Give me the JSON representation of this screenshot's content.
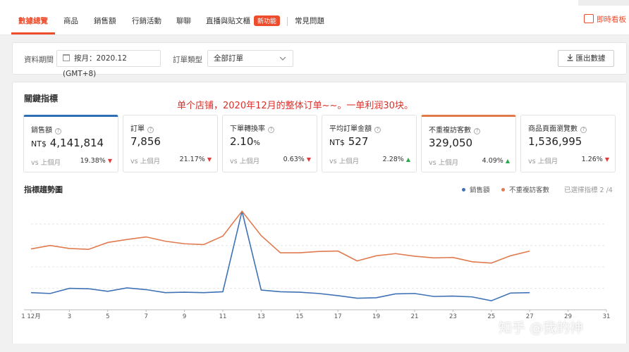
{
  "nav": {
    "tabs": [
      "數據總覽",
      "商品",
      "銷售額",
      "行銷活動",
      "聊聊",
      "直播與貼文櫃"
    ],
    "badge": "新功能",
    "faq": "常見問題",
    "dashboard": "即時看板"
  },
  "filters": {
    "period_label": "資料期間",
    "period_value": "按月：2020.12 (GMT+8)",
    "order_type_label": "訂單類型",
    "order_type_value": "全部訂單",
    "export_label": "匯出數據"
  },
  "metrics": {
    "title": "關鍵指標",
    "annotation": "单个店铺，2020年12月的整体订单~~。一单利润30块。",
    "cards": [
      {
        "label": "銷售額",
        "prefix": "NT$",
        "value": "4,141,814",
        "suffix": "",
        "vs": "vs 上個月",
        "change": "19.38%",
        "direction": "down"
      },
      {
        "label": "訂單",
        "prefix": "",
        "value": "7,856",
        "suffix": "",
        "vs": "vs 上個月",
        "change": "21.17%",
        "direction": "down"
      },
      {
        "label": "下單轉換率",
        "prefix": "",
        "value": "2.10",
        "suffix": "%",
        "vs": "vs 上個月",
        "change": "0.63%",
        "direction": "down"
      },
      {
        "label": "平均訂單金額",
        "prefix": "NT$",
        "value": "527",
        "suffix": "",
        "vs": "vs 上個月",
        "change": "2.28%",
        "direction": "up"
      },
      {
        "label": "不重複訪客數",
        "prefix": "",
        "value": "329,050",
        "suffix": "",
        "vs": "vs 上個月",
        "change": "4.09%",
        "direction": "up"
      },
      {
        "label": "商品頁面瀏覽數",
        "prefix": "",
        "value": "1,536,995",
        "suffix": "",
        "vs": "vs 上個月",
        "change": "1.26%",
        "direction": "down"
      }
    ]
  },
  "trend": {
    "title": "指標趨勢圖",
    "legend": [
      "銷售額",
      "不重複訪客數"
    ],
    "selected_note": "已選擇指標 2 /4"
  },
  "chart_data": {
    "type": "line",
    "x": [
      1,
      2,
      3,
      4,
      5,
      6,
      7,
      8,
      9,
      10,
      11,
      12,
      13,
      14,
      15,
      16,
      17,
      18,
      19,
      20,
      21,
      22,
      23,
      24,
      25,
      26,
      27
    ],
    "x_ticks": [
      "1 12月",
      "3",
      "5",
      "7",
      "9",
      "11",
      "13",
      "15",
      "17",
      "19",
      "21",
      "23",
      "25",
      "27",
      "29",
      "31"
    ],
    "xlim": [
      1,
      31
    ],
    "series": [
      {
        "name": "銷售額",
        "color": "#3f72b5",
        "values": [
          0.4,
          0.38,
          0.5,
          0.49,
          0.43,
          0.51,
          0.47,
          0.4,
          0.41,
          0.4,
          0.42,
          2.3,
          0.46,
          0.42,
          0.41,
          0.38,
          0.33,
          0.27,
          0.28,
          0.37,
          0.38,
          0.31,
          0.32,
          0.3,
          0.21,
          0.39,
          0.4
        ]
      },
      {
        "name": "不重複訪客數",
        "color": "#e07b50",
        "values": [
          1.42,
          1.5,
          1.43,
          1.41,
          1.57,
          1.64,
          1.7,
          1.6,
          1.54,
          1.52,
          1.72,
          2.3,
          1.73,
          1.33,
          1.33,
          1.36,
          1.37,
          1.14,
          1.26,
          1.31,
          1.25,
          1.21,
          1.22,
          1.12,
          1.09,
          1.26,
          1.37
        ]
      }
    ],
    "grid": true,
    "legend_position": "top-right"
  },
  "watermark": "知乎 @我的神"
}
